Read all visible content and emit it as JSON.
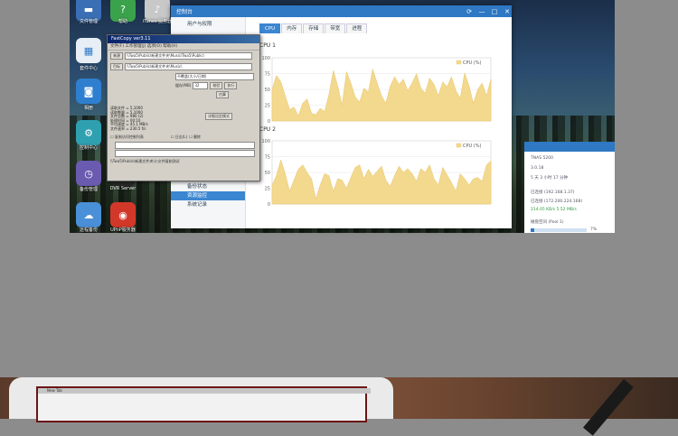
{
  "desktop": {
    "icons": [
      {
        "label": "文件管理",
        "color": "#3b6fb5",
        "icon": "folder-icon",
        "glyph": "▬"
      },
      {
        "label": "帮助",
        "color": "#3aa24a",
        "icon": "help-icon",
        "glyph": "?"
      },
      {
        "label": "iTunes 服务器",
        "color": "#c8c8c8",
        "icon": "itunes-icon",
        "glyph": "♪"
      },
      {
        "label": "套件中心",
        "color": "#e8eef5",
        "icon": "package-center-icon",
        "glyph": "▦"
      },
      {
        "label": "相册",
        "color": "#2e7fd0",
        "icon": "photo-icon",
        "glyph": "◙"
      },
      {
        "label": "控制中心",
        "color": "#2fa0b0",
        "icon": "control-center-icon",
        "glyph": "⚙"
      },
      {
        "label": "备份管理",
        "color": "#6a5bb0",
        "icon": "backup-icon",
        "glyph": "◷"
      },
      {
        "label": "DVR Server",
        "color": "#2a2a2a",
        "icon": "dvr-icon",
        "glyph": "▣"
      },
      {
        "label": "远程备份",
        "color": "#4a90d8",
        "icon": "cloud-icon",
        "glyph": "☁"
      },
      {
        "label": "UPnP服务器",
        "color": "#d2382a",
        "icon": "upnp-icon",
        "glyph": "◉"
      }
    ]
  },
  "control_panel": {
    "title": "控制台",
    "window_controls": [
      "⟳",
      "—",
      "□",
      "✕"
    ],
    "sidebar_top": "用户与权限",
    "sidebar_bottom": [
      "备份状态",
      "资源监控",
      "系统记录"
    ],
    "tabs": [
      "CPU",
      "内存",
      "存储",
      "带宽",
      "进程"
    ],
    "active_tab": "CPU",
    "cpu1_label": "CPU 1",
    "cpu2_label": "CPU 2",
    "legend": "CPU (%)"
  },
  "chart_data": [
    {
      "type": "area",
      "title": "CPU 1",
      "ylim": [
        0,
        100
      ],
      "yticks": [
        "100",
        "75",
        "50",
        "25",
        "0"
      ],
      "series": [
        {
          "name": "CPU (%)",
          "color": "#f3d98e",
          "values": [
            50,
            72,
            62,
            40,
            18,
            22,
            8,
            28,
            35,
            12,
            10,
            20,
            15,
            42,
            80,
            55,
            25,
            78,
            60,
            38,
            30,
            52,
            46,
            82,
            60,
            40,
            28,
            55,
            70,
            58,
            66,
            48,
            60,
            75,
            52,
            44,
            68,
            58,
            40,
            62,
            54,
            70,
            48,
            36,
            76,
            56,
            28,
            50,
            60,
            40,
            66
          ]
        }
      ]
    },
    {
      "type": "area",
      "title": "CPU 2",
      "ylim": [
        0,
        100
      ],
      "yticks": [
        "100",
        "75",
        "50",
        "25",
        "0"
      ],
      "series": [
        {
          "name": "CPU (%)",
          "color": "#f3d98e",
          "values": [
            30,
            45,
            70,
            48,
            20,
            38,
            55,
            62,
            50,
            40,
            8,
            30,
            48,
            45,
            20,
            40,
            38,
            25,
            42,
            58,
            62,
            40,
            55,
            44,
            52,
            60,
            38,
            28,
            45,
            60,
            50,
            56,
            48,
            36,
            56,
            50,
            62,
            40,
            30,
            58,
            46,
            34,
            20,
            48,
            40,
            30,
            40,
            42,
            36,
            62,
            68
          ]
        }
      ]
    }
  ],
  "fastcopy": {
    "title": "FastCopy ver3.11",
    "menu": "文件(F)  工作管理(J)  选项(O)  帮助(H)",
    "source_btn": "来源",
    "source_path": "\\\\Twa5\\Public\\新建文件夹\\Music\\Twa5\\Public\\",
    "dest_btn": "目标",
    "dest_path": "\\\\Twa5\\Public\\新建文件夹\\Music\\",
    "mode": "不覆盖(大小/日期)",
    "buffer_label": "缓存(MB)",
    "buffer_value": "32",
    "verify": "校验",
    "execute": "执行",
    "estimate": "估算",
    "options": [
      "详细设定模式"
    ],
    "checks": [
      "复制访问控制列表",
      "日志(L)",
      "删除"
    ],
    "log": "读取文件 = 5,1000\n读取数量 = 5,1000\n文件总数 = 980 (2)\n处理时间 = 00:10\n平均速度 = 45.1 MB/s\n文件速率 = 230.5 f/s",
    "status": "\\\\Twa5\\Public\\新建文件夹\\小文件复制测试"
  },
  "info_panel": {
    "lines": [
      "TNAS 5200",
      "3.0.18",
      "5 天 3 小时 17 分钟",
      "已连接 (192.168.1.37)",
      "已连接 (172.200.224.168)",
      "214.05 KB/s   5.52 MB/s",
      "磁盘空间 (Pool 1)",
      "7%"
    ]
  },
  "laptop": {
    "tab": "New Tab"
  }
}
